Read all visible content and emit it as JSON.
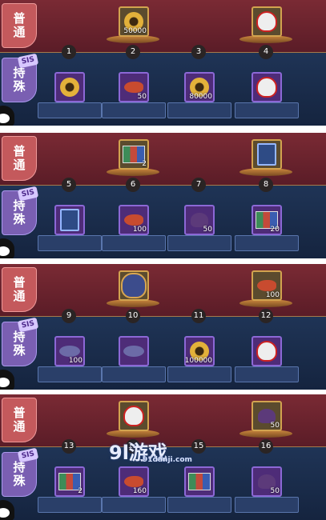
{
  "panels": [
    {
      "normal_label": [
        "普",
        "通"
      ],
      "special_label": [
        "持",
        "殊"
      ],
      "stamp": "SIS",
      "numbers": [
        "1",
        "2",
        "3",
        "4"
      ],
      "normal_items": [
        {
          "slot": 2,
          "type": "coin",
          "qty": "50000"
        },
        {
          "slot": 4,
          "type": "daruma",
          "qty": ""
        }
      ],
      "special_items": [
        {
          "slot": 1,
          "type": "gold-orb",
          "qty": ""
        },
        {
          "slot": 2,
          "type": "fish",
          "qty": "50"
        },
        {
          "slot": 3,
          "type": "coin",
          "qty": "80000"
        },
        {
          "slot": 4,
          "type": "daruma",
          "qty": ""
        }
      ]
    },
    {
      "normal_label": [
        "普",
        "通"
      ],
      "special_label": [
        "持",
        "殊"
      ],
      "stamp": "SIS",
      "numbers": [
        "5",
        "6",
        "7",
        "8"
      ],
      "normal_items": [
        {
          "slot": 2,
          "type": "cards",
          "qty": "2"
        },
        {
          "slot": 4,
          "type": "book",
          "qty": ""
        }
      ],
      "special_items": [
        {
          "slot": 1,
          "type": "book",
          "qty": ""
        },
        {
          "slot": 2,
          "type": "fish",
          "qty": "100"
        },
        {
          "slot": 3,
          "type": "fox",
          "qty": "50"
        },
        {
          "slot": 4,
          "type": "cards",
          "qty": "20"
        }
      ]
    },
    {
      "normal_label": [
        "普",
        "通"
      ],
      "special_label": [
        "持",
        "殊"
      ],
      "stamp": "SIS",
      "numbers": [
        "9",
        "10",
        "11",
        "12"
      ],
      "normal_items": [
        {
          "slot": 2,
          "type": "bag",
          "qty": ""
        },
        {
          "slot": 4,
          "type": "fish",
          "qty": "100"
        }
      ],
      "special_items": [
        {
          "slot": 1,
          "type": "cloud",
          "qty": "100"
        },
        {
          "slot": 2,
          "type": "cloud",
          "qty": ""
        },
        {
          "slot": 3,
          "type": "coin",
          "qty": "100000"
        },
        {
          "slot": 4,
          "type": "daruma",
          "qty": ""
        }
      ]
    },
    {
      "normal_label": [
        "普",
        "通"
      ],
      "special_label": [
        "持",
        "殊"
      ],
      "stamp": "SIS",
      "numbers": [
        "13",
        "14",
        "15",
        "16"
      ],
      "normal_items": [
        {
          "slot": 2,
          "type": "daruma",
          "qty": ""
        },
        {
          "slot": 4,
          "type": "fox",
          "qty": "50"
        }
      ],
      "special_items": [
        {
          "slot": 1,
          "type": "cards",
          "qty": "2"
        },
        {
          "slot": 2,
          "type": "fish",
          "qty": "160"
        },
        {
          "slot": 3,
          "type": "cards",
          "qty": ""
        },
        {
          "slot": 4,
          "type": "fox",
          "qty": "50"
        }
      ]
    }
  ],
  "watermark": {
    "main": "9l游戏",
    "sub": "91danji.com"
  }
}
